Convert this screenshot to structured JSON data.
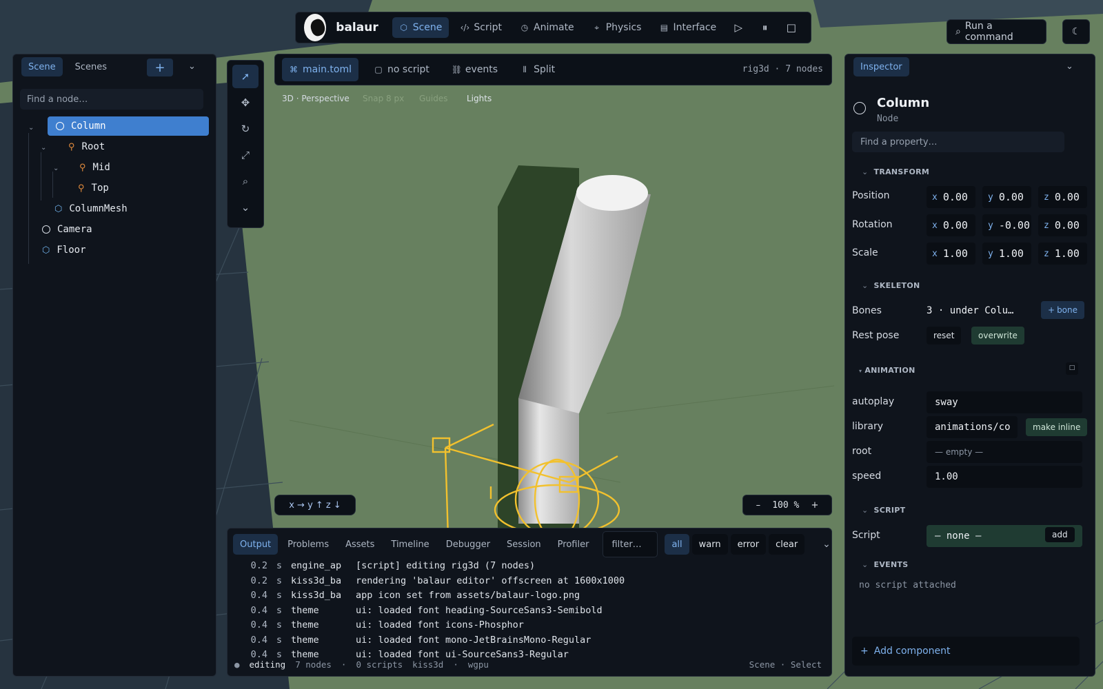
{
  "topbar": {
    "brand": "balaur",
    "tabs": [
      {
        "label": "Scene",
        "icon": "cube-icon"
      },
      {
        "label": "Script",
        "icon": "code-icon"
      },
      {
        "label": "Animate",
        "icon": "clock-icon"
      },
      {
        "label": "Physics",
        "icon": "physics-icon"
      },
      {
        "label": "Interface",
        "icon": "layout-icon"
      }
    ],
    "command": "Run a command"
  },
  "left_panel": {
    "tabs": [
      "Scene",
      "Scenes"
    ],
    "search_placeholder": "Find a node…",
    "tree": [
      {
        "label": "Column",
        "icon": "node-circle-icon",
        "selected": true
      },
      {
        "label": "Root",
        "icon": "bone-icon"
      },
      {
        "label": "Mid",
        "icon": "bone-icon"
      },
      {
        "label": "Top",
        "icon": "bone-icon"
      },
      {
        "label": "ColumnMesh",
        "icon": "mesh-cube-icon"
      },
      {
        "label": "Camera",
        "icon": "node-circle-icon"
      },
      {
        "label": "Floor",
        "icon": "mesh-cube-icon"
      }
    ]
  },
  "editor_tabs": {
    "tabs": [
      "main.toml",
      "no script",
      "events",
      "Split"
    ],
    "info": "rig3d · 7 nodes"
  },
  "viewport": {
    "labels": [
      "3D · Perspective",
      "Snap 8 px",
      "Guides",
      "Lights"
    ],
    "axes": "x → y ↑ z ↓",
    "zoom": "100 %"
  },
  "console": {
    "tabs": [
      "Output",
      "Problems",
      "Assets",
      "Timeline",
      "Debugger",
      "Session",
      "Profiler"
    ],
    "filter_placeholder": "filter…",
    "levels": [
      "all",
      "warn",
      "error"
    ],
    "clear": "clear",
    "logs": [
      {
        "t": "0.2",
        "u": "s",
        "src": "engine_ap",
        "msg": "[script] editing rig3d (7 nodes)"
      },
      {
        "t": "0.2",
        "u": "s",
        "src": "kiss3d_ba",
        "msg": "rendering 'balaur editor' offscreen at 1600x1000"
      },
      {
        "t": "0.4",
        "u": "s",
        "src": "kiss3d_ba",
        "msg": "app icon set from assets/balaur-logo.png"
      },
      {
        "t": "0.4",
        "u": "s",
        "src": "theme",
        "msg": "ui: loaded font heading-SourceSans3-Semibold"
      },
      {
        "t": "0.4",
        "u": "s",
        "src": "theme",
        "msg": "ui: loaded font icons-Phosphor"
      },
      {
        "t": "0.4",
        "u": "s",
        "src": "theme",
        "msg": "ui: loaded font mono-JetBrainsMono-Regular"
      },
      {
        "t": "0.4",
        "u": "s",
        "src": "theme",
        "msg": "ui: loaded font ui-SourceSans3-Regular"
      }
    ],
    "status": {
      "bullet": "●",
      "mode": "editing",
      "nodes": "7 nodes",
      "sep1": "·",
      "scripts": "0 scripts",
      "renderer": "kiss3d",
      "sep2": "·",
      "backend": "wgpu",
      "right": "Scene · Select"
    }
  },
  "inspector": {
    "tab": "Inspector",
    "title": "Column",
    "kind": "Node",
    "search_placeholder": "Find a property…",
    "transform": {
      "heading": "TRANSFORM",
      "rows": [
        {
          "label": "Position",
          "x": "0.00",
          "y": "0.00",
          "z": "0.00"
        },
        {
          "label": "Rotation",
          "x": "0.00",
          "y": "-0.00",
          "z": "0.00"
        },
        {
          "label": "Scale",
          "x": "1.00",
          "y": "1.00",
          "z": "1.00"
        }
      ]
    },
    "skeleton": {
      "heading": "SKELETON",
      "bones_label": "Bones",
      "bones_value": "3 · under Colu…",
      "add_bone": "bone",
      "rest_label": "Rest pose",
      "reset": "reset",
      "overwrite": "overwrite"
    },
    "animation": {
      "heading": "ANIMATION",
      "autoplay_label": "autoplay",
      "autoplay": "sway",
      "library_label": "library",
      "library": "animations/co",
      "make_inline": "make inline",
      "root_label": "root",
      "root": "— empty —",
      "speed_label": "speed",
      "speed": "1.00"
    },
    "script": {
      "heading": "SCRIPT",
      "label": "Script",
      "value": "— none —",
      "add": "add"
    },
    "events": {
      "heading": "EVENTS",
      "empty": "no script attached"
    },
    "add_component": "Add component"
  },
  "colors": {
    "accent": "#7fb2ee",
    "selection": "#3f7fcf",
    "viewport_bg": "#67805f",
    "gizmo": "#f2c12e"
  }
}
